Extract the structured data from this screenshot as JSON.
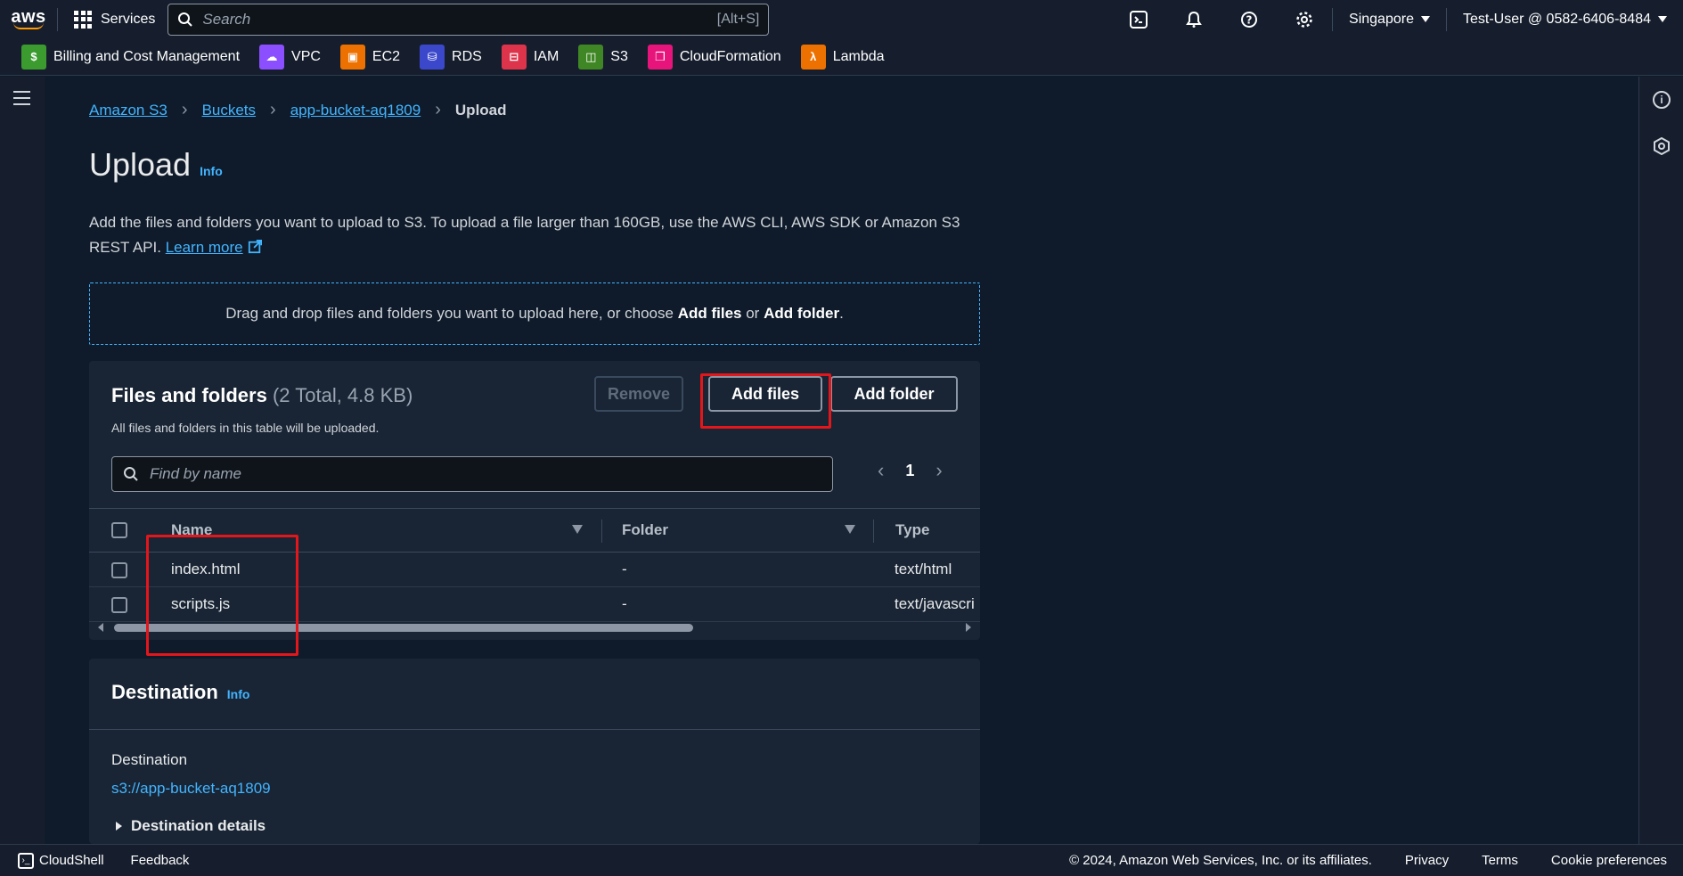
{
  "topbar": {
    "logo_text": "aws",
    "services_label": "Services",
    "search_placeholder": "Search",
    "search_shortcut": "[Alt+S]",
    "region": "Singapore",
    "account": "Test-User @ 0582-6406-8484"
  },
  "favorites": [
    {
      "label": "Billing and Cost Management",
      "icon": "billing-icon",
      "color": "#3b9b2f"
    },
    {
      "label": "VPC",
      "icon": "vpc-icon",
      "color": "#8c4fff"
    },
    {
      "label": "EC2",
      "icon": "ec2-icon",
      "color": "#ed7100"
    },
    {
      "label": "RDS",
      "icon": "rds-icon",
      "color": "#3b48cc"
    },
    {
      "label": "IAM",
      "icon": "iam-icon",
      "color": "#dd344c"
    },
    {
      "label": "S3",
      "icon": "s3-icon",
      "color": "#3f8624"
    },
    {
      "label": "CloudFormation",
      "icon": "cloudformation-icon",
      "color": "#e7157b"
    },
    {
      "label": "Lambda",
      "icon": "lambda-icon",
      "color": "#ed7100"
    }
  ],
  "breadcrumb": {
    "items": [
      "Amazon S3",
      "Buckets",
      "app-bucket-aq1809"
    ],
    "current": "Upload"
  },
  "page": {
    "title": "Upload",
    "info": "Info",
    "description": "Add the files and folders you want to upload to S3. To upload a file larger than 160GB, use the AWS CLI, AWS SDK or Amazon S3 REST API.",
    "learn_more": "Learn more",
    "dropzone_prefix": "Drag and drop files and folders you want to upload here, or choose ",
    "dropzone_add_files": "Add files",
    "dropzone_or": " or ",
    "dropzone_add_folder": "Add folder",
    "dropzone_suffix": "."
  },
  "files_panel": {
    "title": "Files and folders",
    "summary": "(2 Total, 4.8 KB)",
    "subtitle": "All files and folders in this table will be uploaded.",
    "remove_label": "Remove",
    "add_files_label": "Add files",
    "add_folder_label": "Add folder",
    "find_placeholder": "Find by name",
    "page": "1",
    "columns": [
      "Name",
      "Folder",
      "Type"
    ],
    "rows": [
      {
        "name": "index.html",
        "folder": "-",
        "type": "text/html"
      },
      {
        "name": "scripts.js",
        "folder": "-",
        "type": "text/javascri"
      }
    ]
  },
  "destination": {
    "title": "Destination",
    "info": "Info",
    "label": "Destination",
    "value": "s3://app-bucket-aq1809",
    "details_label": "Destination details"
  },
  "footer": {
    "cloudshell": "CloudShell",
    "feedback": "Feedback",
    "copyright": "© 2024, Amazon Web Services, Inc. or its affiliates.",
    "privacy": "Privacy",
    "terms": "Terms",
    "cookies": "Cookie preferences"
  },
  "colors": {
    "link": "#42b4ff",
    "highlight": "#e3161b",
    "accent": "#ff9900"
  }
}
